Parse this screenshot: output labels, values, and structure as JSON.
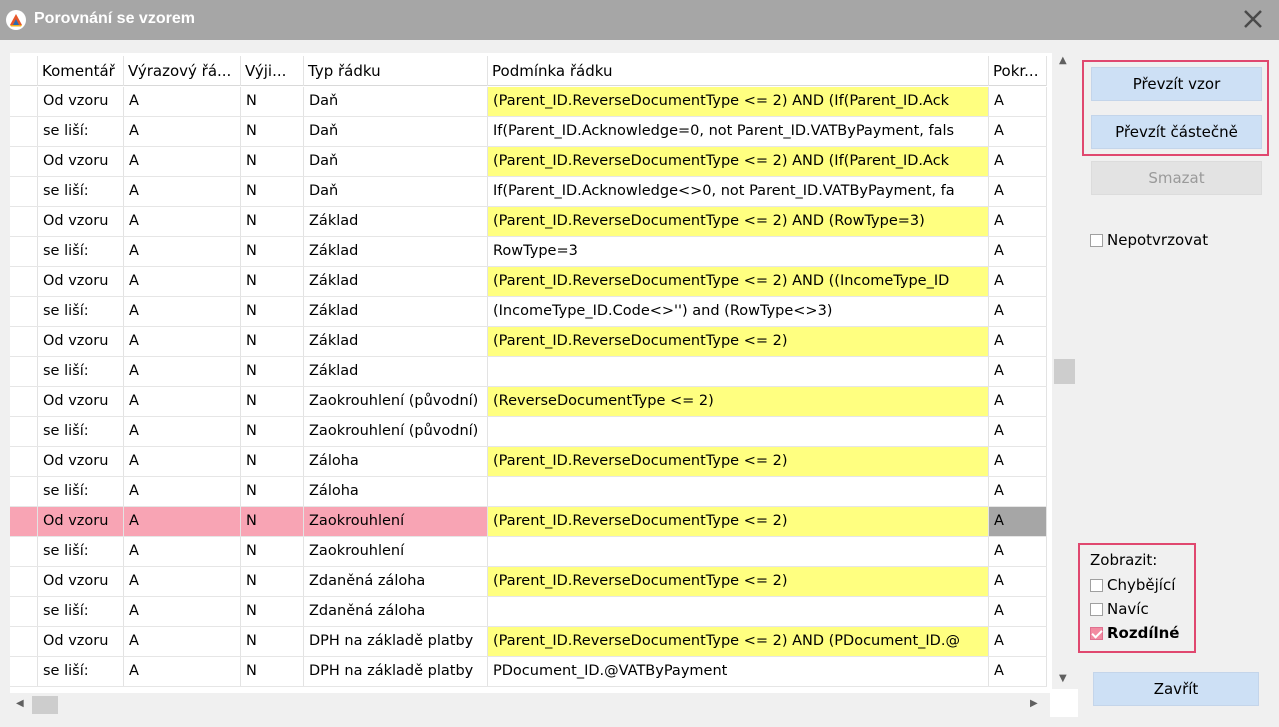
{
  "window": {
    "title": "Porovnání se vzorem"
  },
  "columns": [
    "",
    "Komentář",
    "Výrazový řá...",
    "Výji...",
    "Typ řádku",
    "Podmínka řádku",
    "Pokr..."
  ],
  "rows": [
    {
      "c": [
        "",
        "Od vzoru",
        "A",
        "N",
        "Daň",
        "(Parent_ID.ReverseDocumentType <= 2) AND (If(Parent_ID.Ack",
        "A"
      ],
      "hl": true
    },
    {
      "c": [
        "",
        "se liší:",
        "A",
        "N",
        "Daň",
        "If(Parent_ID.Acknowledge=0, not Parent_ID.VATByPayment, fals",
        "A"
      ],
      "hl": false
    },
    {
      "c": [
        "",
        "Od vzoru",
        "A",
        "N",
        "Daň",
        "(Parent_ID.ReverseDocumentType <= 2) AND (If(Parent_ID.Ack",
        "A"
      ],
      "hl": true
    },
    {
      "c": [
        "",
        "se liší:",
        "A",
        "N",
        "Daň",
        "If(Parent_ID.Acknowledge<>0, not Parent_ID.VATByPayment, fa",
        "A"
      ],
      "hl": false
    },
    {
      "c": [
        "",
        "Od vzoru",
        "A",
        "N",
        "Základ",
        "(Parent_ID.ReverseDocumentType <= 2) AND (RowType=3)",
        "A"
      ],
      "hl": true
    },
    {
      "c": [
        "",
        "se liší:",
        "A",
        "N",
        "Základ",
        "RowType=3",
        "A"
      ],
      "hl": false
    },
    {
      "c": [
        "",
        "Od vzoru",
        "A",
        "N",
        "Základ",
        "(Parent_ID.ReverseDocumentType <= 2) AND ((IncomeType_ID",
        "A"
      ],
      "hl": true
    },
    {
      "c": [
        "",
        "se liší:",
        "A",
        "N",
        "Základ",
        "(IncomeType_ID.Code<>'') and (RowType<>3)",
        "A"
      ],
      "hl": false
    },
    {
      "c": [
        "",
        "Od vzoru",
        "A",
        "N",
        "Základ",
        "(Parent_ID.ReverseDocumentType <= 2)",
        "A"
      ],
      "hl": true
    },
    {
      "c": [
        "",
        "se liší:",
        "A",
        "N",
        "Základ",
        "",
        "A"
      ],
      "hl": false
    },
    {
      "c": [
        "",
        "Od vzoru",
        "A",
        "N",
        "Zaokrouhlení (původní)",
        "(ReverseDocumentType <= 2)",
        "A"
      ],
      "hl": true
    },
    {
      "c": [
        "",
        "se liší:",
        "A",
        "N",
        "Zaokrouhlení (původní)",
        "",
        "A"
      ],
      "hl": false
    },
    {
      "c": [
        "",
        "Od vzoru",
        "A",
        "N",
        "Záloha",
        "(Parent_ID.ReverseDocumentType <= 2)",
        "A"
      ],
      "hl": true
    },
    {
      "c": [
        "",
        "se liší:",
        "A",
        "N",
        "Záloha",
        "",
        "A"
      ],
      "hl": false
    },
    {
      "c": [
        "",
        "Od vzoru",
        "A",
        "N",
        "Zaokrouhlení",
        "(Parent_ID.ReverseDocumentType <= 2)",
        "A"
      ],
      "hl": true,
      "selected": true
    },
    {
      "c": [
        "",
        "se liší:",
        "A",
        "N",
        "Zaokrouhlení",
        "",
        "A"
      ],
      "hl": false
    },
    {
      "c": [
        "",
        "Od vzoru",
        "A",
        "N",
        "Zdaněná záloha",
        "(Parent_ID.ReverseDocumentType <= 2)",
        "A"
      ],
      "hl": true
    },
    {
      "c": [
        "",
        "se liší:",
        "A",
        "N",
        "Zdaněná záloha",
        "",
        "A"
      ],
      "hl": false
    },
    {
      "c": [
        "",
        "Od vzoru",
        "A",
        "N",
        "DPH na základě platby",
        "(Parent_ID.ReverseDocumentType <= 2) AND (PDocument_ID.@",
        "A"
      ],
      "hl": true
    },
    {
      "c": [
        "",
        "se liší:",
        "A",
        "N",
        "DPH na základě platby",
        "PDocument_ID.@VATByPayment",
        "A"
      ],
      "hl": false
    }
  ],
  "buttons": {
    "take_template": "Převzít vzor",
    "take_partial": "Převzít částečně",
    "delete": "Smazat",
    "close": "Zavřít"
  },
  "options": {
    "no_confirm": "Nepotvrzovat"
  },
  "show": {
    "label": "Zobrazit:",
    "missing": "Chybějící",
    "extra": "Navíc",
    "different": "Rozdílné"
  },
  "colors": {
    "highlight": "#ffff80",
    "selected_row": "#f8a4b4",
    "accent_border": "#e0486f",
    "button": "#cde0f5"
  }
}
